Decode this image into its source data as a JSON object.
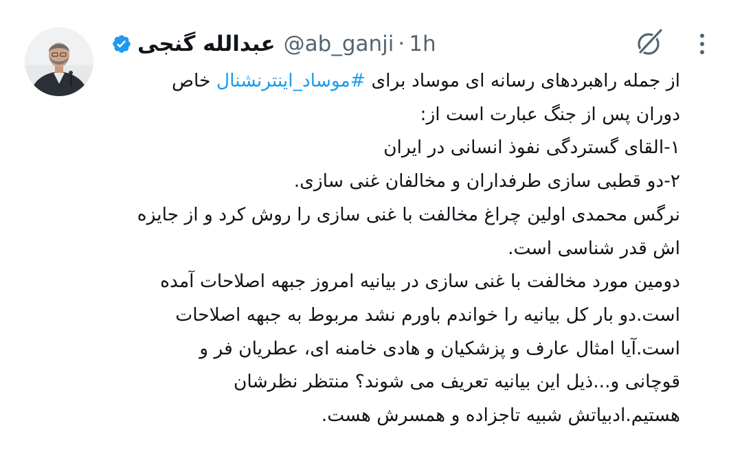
{
  "tweet": {
    "author": {
      "display_name": "عبدالله گنجی",
      "handle": "@ab_ganji",
      "verified": true
    },
    "separator": "·",
    "timestamp": "1h",
    "line1_before": "از جمله راهبردهای رسانه ای موساد برای ",
    "hashtag": "#موساد_اینترنشنال",
    "line1_after": " خاص",
    "lines": [
      "دوران پس از جنگ عبارت است از:",
      "۱-القای گستردگی نفوذ انسانی در ایران",
      "۲-دو قطبی سازی طرفداران و مخالفان غنی سازی.",
      "نرگس محمدی اولین چراغ مخالفت با غنی سازی را روش کرد و از جایزه",
      "اش قدر شناسی است.",
      "دومین مورد مخالفت با غنی سازی در بیانیه امروز جبهه اصلاحات آمده",
      "است.دو بار کل بیانیه را خواندم باورم نشد مربوط به جبهه اصلاحات",
      "است.آیا امثال عارف و پزشکیان و هادی خامنه ای، عطریان فر و",
      "قوچانی و...ذیل این بیانیه تعریف می شوند؟ منتظر نظرشان",
      "هستیم.ادبیاتش شبیه تاجزاده و همسرش هست."
    ]
  },
  "icons": {
    "avatar": "profile-photo",
    "verified": "verified-badge-icon",
    "grok": "grok-icon",
    "more": "more-vertical-icon"
  },
  "colors": {
    "text": "#0f1419",
    "secondary": "#536471",
    "accent": "#1d9bf0"
  }
}
